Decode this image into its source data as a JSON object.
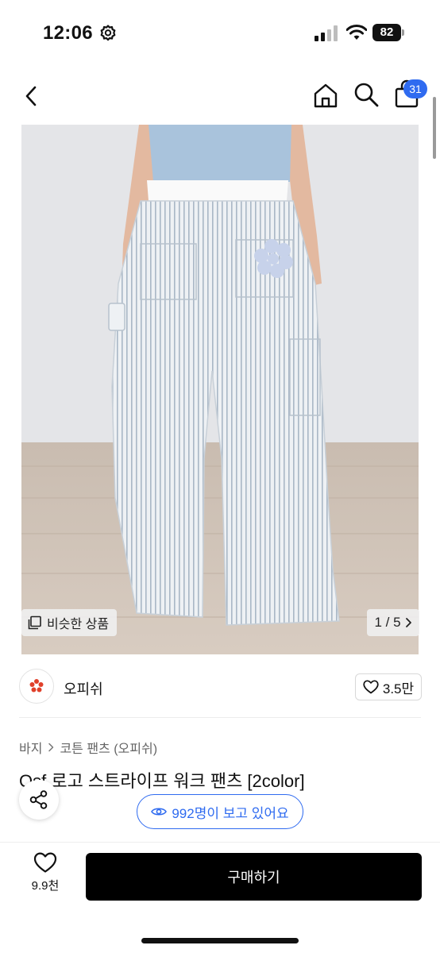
{
  "status_bar": {
    "time": "12:06",
    "battery": "82"
  },
  "nav": {
    "cart_count": "31"
  },
  "gallery": {
    "similar_label": "비슷한 상품",
    "page": "1 / 5"
  },
  "brand": {
    "name": "오피쉬",
    "likes": "3.5만"
  },
  "breadcrumb": {
    "category": "바지",
    "subcategory": "코튼 팬츠 (오피쉬)"
  },
  "product": {
    "title": "Osf 로고 스트라이프 워크 팬츠 [2color]"
  },
  "viewers": {
    "label": "992명이 보고 있어요"
  },
  "bottom_bar": {
    "wish_count": "9.9천",
    "buy_label": "구매하기"
  },
  "colors": {
    "accent": "#2f6bf0",
    "buy_button": "#000000",
    "logo_red": "#e0402a"
  }
}
